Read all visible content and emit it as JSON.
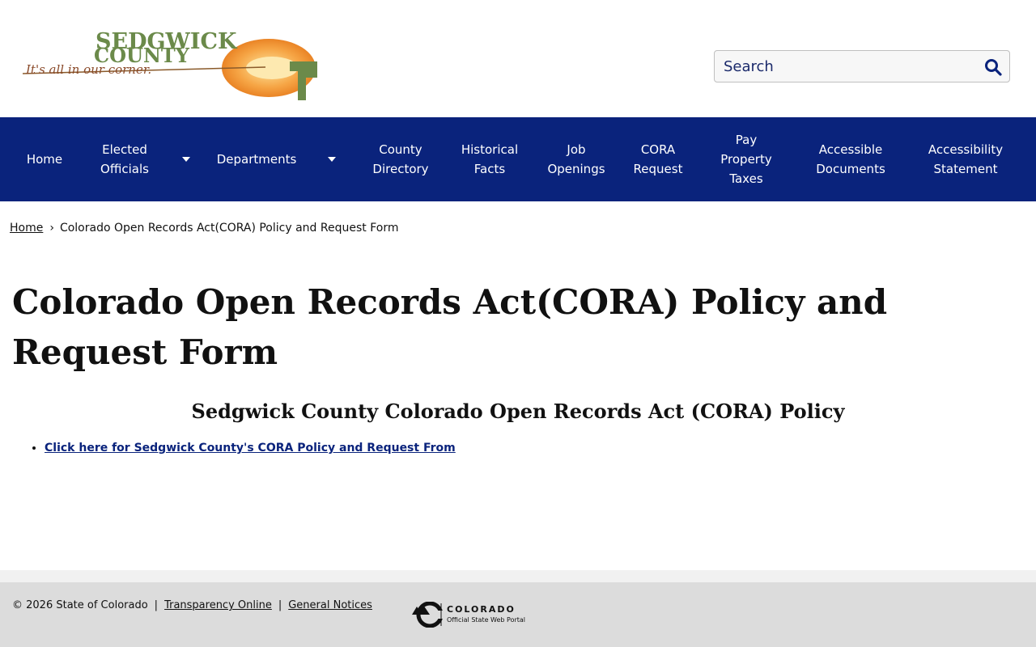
{
  "header": {
    "logo": {
      "line1": "SEDGWICK",
      "line2": "COUNTY",
      "tagline": "It's all in our corner."
    },
    "search": {
      "placeholder": "Search"
    }
  },
  "nav": {
    "items": [
      {
        "label": "Home"
      },
      {
        "label": "Elected Officials",
        "lines": [
          "Elected",
          "Officials"
        ]
      },
      {
        "label": "Departments"
      },
      {
        "label": "County Directory",
        "lines": [
          "County",
          "Directory"
        ]
      },
      {
        "label": "Historical Facts",
        "lines": [
          "Historical",
          "Facts"
        ]
      },
      {
        "label": "Job Openings",
        "lines": [
          "Job",
          "Openings"
        ]
      },
      {
        "label": "CORA Request",
        "lines": [
          "CORA",
          "Request"
        ]
      },
      {
        "label": "Pay Property Taxes",
        "lines": [
          "Pay",
          "Property",
          "Taxes"
        ]
      },
      {
        "label": "Accessible Documents",
        "lines": [
          "Accessible",
          "Documents"
        ]
      },
      {
        "label": "Accessibility Statement",
        "lines": [
          "Accessibility",
          "Statement"
        ]
      }
    ]
  },
  "breadcrumb": {
    "home": "Home",
    "separator": "›",
    "current": "Colorado Open Records Act(CORA) Policy and Request Form"
  },
  "main": {
    "title": "Colorado Open Records Act(CORA) Policy and Request Form",
    "section_heading": "Sedgwick County Colorado Open Records Act (CORA) Policy",
    "links": [
      {
        "label": "Click here for Sedgwick County's CORA Policy and Request From"
      }
    ]
  },
  "footer": {
    "copyright": "© 2026 State of Colorado",
    "separator": "|",
    "links": [
      "Transparency Online",
      "General Notices"
    ],
    "state_logo": {
      "name": "COLORADO",
      "subtitle": "Official State Web Portal"
    }
  },
  "colors": {
    "nav_bg": "#0a237c",
    "link": "#0a237c",
    "footer_bg": "#dcdcdc",
    "logo_green": "#6b8a4a",
    "logo_orange": "#f08a1e"
  }
}
